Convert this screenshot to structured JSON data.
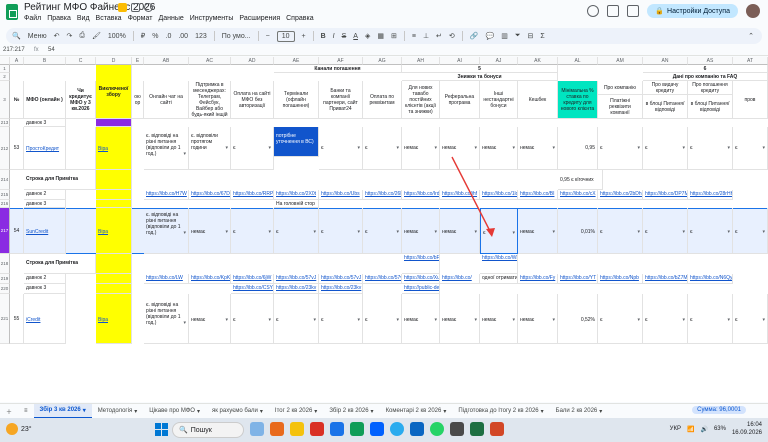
{
  "title": {
    "doc_title": "Рейтинг МФО Файненс 2026",
    "menus": [
      "Файл",
      "Правка",
      "Вид",
      "Вставка",
      "Формат",
      "Данные",
      "Инструменты",
      "Расширения",
      "Справка"
    ],
    "share_label": "Настройки Доступа"
  },
  "toolbar": {
    "search_label": "Меню",
    "zoom": "100%",
    "currency": "₽",
    "percent": "%",
    "dec_less": ".0",
    "dec_more": ".00",
    "number_format": "123",
    "font": "По умо...",
    "font_size": "10"
  },
  "formula_bar": {
    "cell_ref": "217:217",
    "fx": "fx",
    "value": "54"
  },
  "columns": [
    {
      "id": "A",
      "label": "A"
    },
    {
      "id": "B",
      "label": "B"
    },
    {
      "id": "C",
      "label": "C"
    },
    {
      "id": "D",
      "label": "D"
    },
    {
      "id": "E",
      "label": "E"
    },
    {
      "id": "AB",
      "label": "AB"
    },
    {
      "id": "AC",
      "label": "AC"
    },
    {
      "id": "AD",
      "label": "AD"
    },
    {
      "id": "AE",
      "label": "AE"
    },
    {
      "id": "AF",
      "label": "AF"
    },
    {
      "id": "AG",
      "label": "AG"
    },
    {
      "id": "AH",
      "label": "AH"
    },
    {
      "id": "AI",
      "label": "AI"
    },
    {
      "id": "AJ",
      "label": "AJ"
    },
    {
      "id": "AK",
      "label": "AK"
    },
    {
      "id": "AL",
      "label": "AL"
    },
    {
      "id": "AM",
      "label": "AM"
    },
    {
      "id": "AN",
      "label": "AN"
    },
    {
      "id": "AS",
      "label": "AS"
    },
    {
      "id": "AT",
      "label": "AT"
    },
    {
      "id": "AU",
      "label": ""
    }
  ],
  "header": {
    "group_channels": "Канали погашення",
    "group_discounts": "Знижки та бонуси",
    "group_company": "Дані про компанію та FAQ",
    "num5": "5",
    "num6": "6",
    "col_no": "№",
    "col_mfo": "МФО (онлайн )",
    "col_credit": "Чи кредитує МФО у 3 кв.2026",
    "col_fee": "Виключеної збору",
    "col_e": "ою ор",
    "col_ab": "Онлайн чат на сайті",
    "col_ac": "Підтримка в месенджерах: Телеграм, Фейсбук, Вайбер або будь-який інщій",
    "col_ad": "Оплата на сайті МФО без авторизації",
    "col_ae": "Термінали (офлайн погашення)",
    "col_af": "Банки та компанії партнери, сайт Приват24",
    "col_ag": "Оплата по реквізитам",
    "col_ai": "Для нових тавабо постійних клієнтів (акції та знижки)",
    "col_aj": "Реферальна програма",
    "col_ak": "Інші нестандартні бонуси",
    "col_al": "Кешбек",
    "col_am": "Мінімальна % ставка по кредиту для нового клієнта",
    "col_an": "Про компанію",
    "col_an_sub": "Платіжні реквізити компанії",
    "col_as": "Про видачу кредиту",
    "col_as_sub": "в блоці Питання/відповіді",
    "col_at": "Про погашення кредиту",
    "col_at_sub": "в блоці Питання/відповіді",
    "col_au": "пров"
  },
  "rows": [
    {
      "num": "1",
      "cells": []
    },
    {
      "num": "2",
      "cells": []
    },
    {
      "num": "3",
      "cells": []
    },
    {
      "num": "213",
      "b": "давнок 3"
    },
    {
      "num": "212",
      "a": "53",
      "b": "ПростоКредит",
      "d": "Віра",
      "ab": "є. відповіді на різні питання (відповіли до 1 год.)",
      "ac": "є. відповіли протягом години",
      "ad": "є",
      "ae": "потрібне уточнення в ВС)",
      "af": "є",
      "ag": "є",
      "ai": "немає",
      "aj": "немає",
      "ak": "немає",
      "al": "немає",
      "am": "0,95",
      "an": "є",
      "as": "є",
      "at": "є",
      "au": "є"
    },
    {
      "num": "214",
      "b": "Строка для Примітка",
      "am": "0,95 є кїгочних"
    },
    {
      "num": "215",
      "b": "давнок 2",
      "ab": "https://ibb.co/H7W",
      "ac": "https://ibb.co/67Dq",
      "ad": "https://ibb.co/RRP",
      "ae": "https://ibb.co/2X0t",
      "af": "https://ibb.co/Ubs",
      "ag": "https://ibb.co/26H9",
      "ai": "https://ibb.co/Ird",
      "aj": "https://ibb.co/jhf",
      "ak": "https://ibb.co/1ld",
      "al": "https://ibb.co/BI",
      "am": "https://ibb.co/cX",
      "an": "https://ibb.co/2bDhD",
      "as": "https://ibb.co/DP7M",
      "at": "https://ibb.co/28rHH"
    },
    {
      "num": "216",
      "b": "давнок 3",
      "ae": "На головній стор"
    },
    {
      "num": "217",
      "a": "54",
      "b": "SunCredit",
      "d": "Віра",
      "ab": "є. відповіді на різні питання (відповіли до 1 год.)",
      "ac": "немає",
      "ad": "є",
      "ae": "є",
      "af": "є",
      "ag": "є",
      "ai": "немає",
      "aj": "немає",
      "ak": "є",
      "al": "немає",
      "am": "0,01%",
      "an": "є",
      "as": "є",
      "at": "є",
      "au": "є"
    },
    {
      "num": "218",
      "b": "Строка для Примітка",
      "ai": "https://ibb.co/bF",
      "ak": "https://ibb.co/Wh"
    },
    {
      "num": "219",
      "b": "давнок 2",
      "ab": "https://ibb.co/LW",
      "ac": "https://ibb.co/KpKc",
      "ad": "https://ibb.co/6jW",
      "ae": "https://ibb.co/57vJ",
      "af": "https://ibb.co/57vJ",
      "ag": "https://ibb.co/57vJ",
      "ai": "https://ibb.co/Xu",
      "aj": "https://ibb.co/",
      "ak": "одної отримати",
      "al": "https://ibb.co/Fy",
      "am": "https://ibb.co/YT",
      "an": "https://ibb.co/Npb",
      "as": "https://ibb.co/bZ7M",
      "at": "https://ibb.co/N6Qy"
    },
    {
      "num": "220",
      "b": "давнок 3",
      "ad": "https://ibb.co/CSY",
      "ae": "https://ibb.co/23kv",
      "af": "https://ibb.co/23kv",
      "ai": "https://public-de"
    },
    {
      "num": "221",
      "a": "55",
      "b": "iCredit",
      "d": "Віра",
      "ab": "є. відповіді на різні питання (відповіли до 1 год.)",
      "ac": "немає",
      "ad": "є",
      "ae": "є",
      "af": "є",
      "ag": "є",
      "ai": "немає",
      "aj": "немає",
      "ak": "немає",
      "al": "немає",
      "am": "0,52%",
      "an": "є",
      "as": "є",
      "at": "є",
      "au": "є"
    }
  ],
  "tabs": {
    "active": "Збір 3 кв 2026",
    "items": [
      "Методологія",
      "Цікаве про МФО",
      "як рахуємо бали",
      "Ітог 2 кв 2026",
      "Збір 2 кв 2026",
      "Коментарі 2 кв 2026",
      "Підготовка до Ітогу 2 кв 2026",
      "Бали 2 кв 2026"
    ],
    "sum": "Сумма: 96,0001"
  },
  "taskbar": {
    "temp": "23°",
    "search": "Пошук",
    "lang": "УКР",
    "battery": "63%",
    "time": "16:04",
    "date": "16.09.2026"
  },
  "colors": {
    "accent": "#0b57d0",
    "yellow": "#ffff00",
    "teal": "#00e5c0",
    "blue_note": "#1155cc",
    "arrow_red": "#e53935"
  }
}
